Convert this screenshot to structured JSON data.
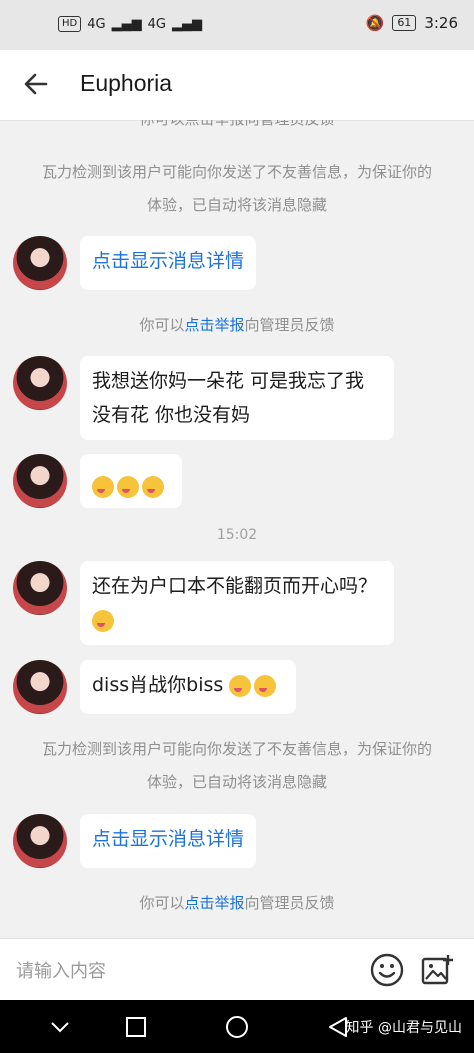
{
  "status_bar": {
    "left_labels": [
      "HD",
      "4G",
      "4G"
    ],
    "battery": "61",
    "time": "3:26"
  },
  "header": {
    "title": "Euphoria"
  },
  "chat": {
    "top_partial_hint": "你可以点击举报向管理员反馈",
    "notice_1": "瓦力检测到该用户可能向你发送了不友善信息，为保证你的体验，已自动将该消息隐藏",
    "show_details_1": "点击显示消息详情",
    "hint_1": {
      "before": "你可以",
      "link": "点击举报",
      "after": "向管理员反馈"
    },
    "msg_1": "我想送你妈一朵花 可是我忘了我没有花 你也没有妈",
    "timestamp": "15:02",
    "msg_3": "还在为户口本不能翻页而开心吗？",
    "msg_4": "diss肖战你biss",
    "notice_2": "瓦力检测到该用户可能向你发送了不友善信息，为保证你的体验，已自动将该消息隐藏",
    "show_details_2": "点击显示消息详情",
    "hint_2": {
      "before": "你可以",
      "link": "点击举报",
      "after": "向管理员反馈"
    }
  },
  "input_bar": {
    "placeholder": "请输入内容"
  },
  "watermark": "知乎 @山君与见山",
  "icons": {
    "back": "arrow-left-icon",
    "emoji": "emoji-icon",
    "image": "image-icon",
    "nav_back": "triangle-back-icon",
    "nav_home": "circle-home-icon",
    "nav_recent": "square-recent-icon"
  }
}
